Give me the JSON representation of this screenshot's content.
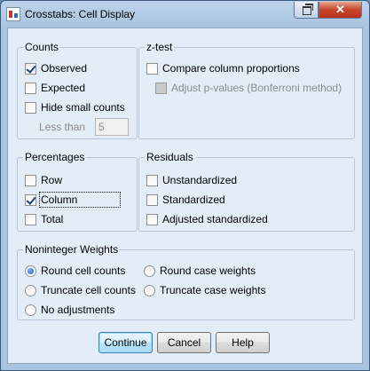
{
  "window": {
    "title": "Crosstabs: Cell Display",
    "close_glyph": "✕"
  },
  "counts": {
    "legend": "Counts",
    "observed": {
      "label": "Observed",
      "checked": true
    },
    "expected": {
      "label": "Expected",
      "checked": false
    },
    "hide_small": {
      "label": "Hide small counts",
      "checked": false
    },
    "less_than_label": "Less than",
    "less_than_value": "5"
  },
  "ztest": {
    "legend": "z-test",
    "compare": {
      "label": "Compare column proportions",
      "checked": false
    },
    "adjust": {
      "label": "Adjust p-values (Bonferroni method)",
      "checked": false,
      "enabled": false
    }
  },
  "percentages": {
    "legend": "Percentages",
    "row": {
      "label": "Row",
      "checked": false
    },
    "column": {
      "label": "Column",
      "checked": true
    },
    "total": {
      "label": "Total",
      "checked": false
    }
  },
  "residuals": {
    "legend": "Residuals",
    "unstandardized": {
      "label": "Unstandardized",
      "checked": false
    },
    "standardized": {
      "label": "Standardized",
      "checked": false
    },
    "adjusted": {
      "label": "Adjusted standardized",
      "checked": false
    }
  },
  "weights": {
    "legend": "Noninteger Weights",
    "selected": "round_cell",
    "options": {
      "round_cell": "Round cell counts",
      "round_case": "Round case weights",
      "truncate_cell": "Truncate cell counts",
      "truncate_case": "Truncate case weights",
      "none": "No adjustments"
    }
  },
  "buttons": {
    "continue": "Continue",
    "cancel": "Cancel",
    "help": "Help"
  }
}
